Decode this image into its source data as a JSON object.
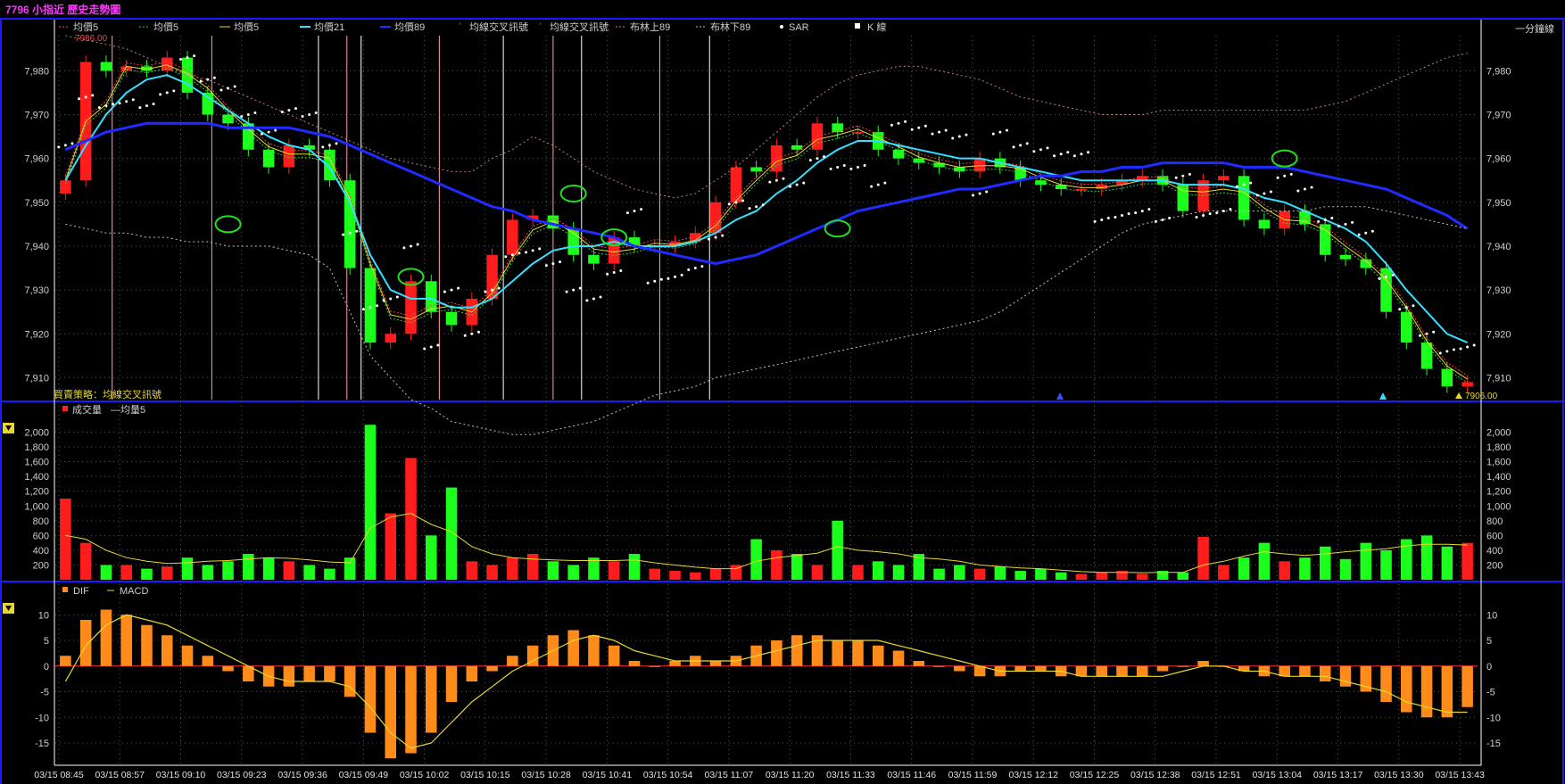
{
  "window": {
    "title": "7796 小指近  歷史走勢圖"
  },
  "price_panel": {
    "period_label": "一分鐘線",
    "high_marker": "7986.00",
    "low_marker": "7906.00",
    "strategy_label": "買賣策略：均線交叉訊號",
    "legend": [
      "均價5",
      "均價5",
      "均價5",
      "均價21",
      "均價89",
      "均線交叉訊號",
      "均線交叉訊號",
      "布林上89",
      "布林下89",
      "SAR",
      "K 線"
    ],
    "colors": {
      "ma5_a": "#ff4040",
      "ma5_b": "#39d039",
      "ma5_c": "#e6d830",
      "ma21": "#33e0ff",
      "ma89": "#1f2bff",
      "boll": "#c08080",
      "sar": "#ffffff",
      "up": "#ff1c1c",
      "down": "#1cff1c"
    }
  },
  "volume_panel": {
    "legend_vol": "成交量",
    "legend_ma": "均量5"
  },
  "macd_panel": {
    "legend_dif": "DIF",
    "legend_macd": "MACD"
  },
  "x_labels": [
    "03/15 08:45",
    "03/15 08:57",
    "03/15 09:10",
    "03/15 09:23",
    "03/15 09:36",
    "03/15 09:49",
    "03/15 10:02",
    "03/15 10:15",
    "03/15 10:28",
    "03/15 10:41",
    "03/15 10:54",
    "03/15 11:07",
    "03/15 11:20",
    "03/15 11:33",
    "03/15 11:46",
    "03/15 11:59",
    "03/15 12:12",
    "03/15 12:25",
    "03/15 12:38",
    "03/15 12:51",
    "03/15 13:04",
    "03/15 13:17",
    "03/15 13:30",
    "03/15 13:43"
  ],
  "chart_data": [
    {
      "type": "candlestick",
      "title": "7796 小指近 歷史走勢圖",
      "ylim": [
        7905,
        7988
      ],
      "yticks": [
        "7,910",
        "7,920",
        "7,930",
        "7,940",
        "7,950",
        "7,960",
        "7,970",
        "7,980"
      ],
      "series": [
        {
          "name": "K 線 (close)",
          "x": [
            "08:45",
            "08:49",
            "08:53",
            "08:57",
            "09:02",
            "09:06",
            "09:10",
            "09:14",
            "09:19",
            "09:23",
            "09:27",
            "09:32",
            "09:36",
            "09:41",
            "09:45",
            "09:49",
            "09:52",
            "09:56",
            "10:02",
            "10:06",
            "10:10",
            "10:15",
            "10:19",
            "10:23",
            "10:28",
            "10:32",
            "10:37",
            "10:41",
            "10:45",
            "10:50",
            "10:54",
            "10:58",
            "11:03",
            "11:07",
            "11:11",
            "11:16",
            "11:20",
            "11:24",
            "11:29",
            "11:33",
            "11:37",
            "11:42",
            "11:46",
            "11:50",
            "11:55",
            "11:59",
            "12:03",
            "12:08",
            "12:12",
            "12:16",
            "12:21",
            "12:25",
            "12:29",
            "12:34",
            "12:38",
            "12:42",
            "12:47",
            "12:51",
            "12:55",
            "13:00",
            "13:04",
            "13:08",
            "13:13",
            "13:17",
            "13:21",
            "13:26",
            "13:30",
            "13:34",
            "13:39",
            "13:43"
          ],
          "values": [
            7955,
            7982,
            7980,
            7981,
            7980,
            7983,
            7975,
            7970,
            7968,
            7962,
            7958,
            7963,
            7962,
            7955,
            7935,
            7918,
            7920,
            7932,
            7925,
            7922,
            7928,
            7938,
            7946,
            7947,
            7944,
            7938,
            7936,
            7942,
            7940,
            7940,
            7941,
            7943,
            7950,
            7958,
            7957,
            7963,
            7962,
            7968,
            7966,
            7966,
            7962,
            7960,
            7959,
            7958,
            7957,
            7960,
            7958,
            7955,
            7954,
            7953,
            7953,
            7954,
            7955,
            7956,
            7954,
            7948,
            7955,
            7956,
            7946,
            7944,
            7948,
            7945,
            7938,
            7937,
            7935,
            7925,
            7918,
            7912,
            7908,
            7909
          ]
        },
        {
          "name": "均價21",
          "values": [
            7955,
            7963,
            7970,
            7975,
            7978,
            7979,
            7977,
            7974,
            7971,
            7968,
            7965,
            7963,
            7962,
            7958,
            7950,
            7938,
            7930,
            7928,
            7928,
            7926,
            7926,
            7928,
            7932,
            7936,
            7939,
            7940,
            7940,
            7941,
            7940,
            7940,
            7940,
            7941,
            7943,
            7946,
            7948,
            7952,
            7955,
            7959,
            7962,
            7964,
            7964,
            7963,
            7962,
            7961,
            7960,
            7960,
            7959,
            7958,
            7957,
            7956,
            7955,
            7955,
            7955,
            7955,
            7955,
            7954,
            7954,
            7954,
            7953,
            7951,
            7950,
            7948,
            7946,
            7944,
            7941,
            7936,
            7930,
            7925,
            7920,
            7918
          ]
        },
        {
          "name": "均價89",
          "values": [
            7962,
            7964,
            7966,
            7967,
            7968,
            7968,
            7968,
            7968,
            7967,
            7967,
            7967,
            7967,
            7966,
            7965,
            7963,
            7961,
            7959,
            7957,
            7955,
            7953,
            7951,
            7949,
            7948,
            7946,
            7945,
            7944,
            7943,
            7942,
            7940,
            7939,
            7938,
            7937,
            7936,
            7937,
            7938,
            7940,
            7942,
            7944,
            7946,
            7948,
            7949,
            7950,
            7951,
            7952,
            7953,
            7953,
            7954,
            7955,
            7956,
            7956,
            7957,
            7957,
            7958,
            7958,
            7959,
            7959,
            7959,
            7959,
            7958,
            7958,
            7958,
            7957,
            7956,
            7955,
            7954,
            7953,
            7951,
            7949,
            7947,
            7944
          ]
        },
        {
          "name": "布林上89",
          "values": [
            7988,
            7987,
            7986,
            7985,
            7983,
            7981,
            7979,
            7978,
            7976,
            7974,
            7972,
            7970,
            7968,
            7966,
            7964,
            7962,
            7960,
            7959,
            7958,
            7957,
            7957,
            7960,
            7962,
            7965,
            7963,
            7960,
            7957,
            7955,
            7953,
            7952,
            7951,
            7952,
            7955,
            7958,
            7962,
            7966,
            7970,
            7974,
            7977,
            7979,
            7980,
            7981,
            7981,
            7980,
            7979,
            7978,
            7976,
            7974,
            7973,
            7972,
            7971,
            7970,
            7970,
            7970,
            7971,
            7971,
            7971,
            7971,
            7971,
            7971,
            7971,
            7971,
            7972,
            7973,
            7975,
            7977,
            7979,
            7981,
            7983,
            7984
          ]
        },
        {
          "name": "布林下89",
          "values": [
            7945,
            7944,
            7943,
            7943,
            7942,
            7942,
            7941,
            7941,
            7940,
            7940,
            7940,
            7939,
            7938,
            7935,
            7925,
            7915,
            7910,
            7905,
            7903,
            7900,
            7899,
            7898,
            7897,
            7897,
            7898,
            7899,
            7900,
            7902,
            7904,
            7906,
            7907,
            7908,
            7910,
            7911,
            7912,
            7913,
            7914,
            7915,
            7916,
            7917,
            7918,
            7919,
            7920,
            7921,
            7922,
            7923,
            7925,
            7928,
            7931,
            7934,
            7937,
            7940,
            7943,
            7945,
            7946,
            7947,
            7948,
            7948,
            7948,
            7948,
            7948,
            7948,
            7949,
            7949,
            7949,
            7948,
            7947,
            7946,
            7945,
            7944
          ]
        }
      ]
    },
    {
      "type": "bar",
      "title": "成交量",
      "ylim": [
        0,
        2200
      ],
      "yticks": [
        "200",
        "400",
        "600",
        "800",
        "1,000",
        "1,200",
        "1,400",
        "1,600",
        "1,800",
        "2,000"
      ],
      "series": [
        {
          "name": "成交量",
          "values": [
            1100,
            500,
            200,
            200,
            150,
            180,
            300,
            200,
            250,
            350,
            300,
            250,
            200,
            150,
            300,
            2100,
            900,
            1650,
            600,
            1250,
            250,
            200,
            300,
            350,
            250,
            200,
            300,
            250,
            350,
            150,
            120,
            100,
            150,
            200,
            550,
            400,
            350,
            200,
            800,
            200,
            250,
            200,
            350,
            150,
            200,
            150,
            180,
            120,
            150,
            100,
            80,
            100,
            120,
            80,
            120,
            100,
            580,
            200,
            300,
            500,
            250,
            300,
            450,
            280,
            500,
            400,
            550,
            600,
            450,
            500
          ]
        },
        {
          "name": "均量5",
          "values": [
            600,
            550,
            400,
            300,
            250,
            220,
            230,
            250,
            260,
            280,
            300,
            290,
            270,
            240,
            230,
            700,
            850,
            900,
            750,
            650,
            450,
            350,
            300,
            280,
            270,
            260,
            260,
            260,
            270,
            230,
            200,
            170,
            150,
            150,
            250,
            300,
            330,
            360,
            450,
            400,
            380,
            350,
            300,
            280,
            250,
            200,
            180,
            160,
            150,
            130,
            110,
            100,
            100,
            95,
            100,
            100,
            200,
            250,
            320,
            380,
            350,
            330,
            350,
            380,
            400,
            420,
            460,
            480,
            480,
            470
          ]
        }
      ]
    },
    {
      "type": "bar",
      "title": "MACD",
      "ylim": [
        -19,
        13
      ],
      "yticks": [
        "-15",
        "-10",
        "-5",
        "0",
        "5",
        "10"
      ],
      "series": [
        {
          "name": "DIF",
          "values": [
            2,
            9,
            11,
            10,
            8,
            6,
            4,
            2,
            -1,
            -3,
            -4,
            -4,
            -3,
            -3,
            -6,
            -13,
            -18,
            -17,
            -13,
            -7,
            -3,
            -1,
            2,
            4,
            6,
            7,
            6,
            4,
            1,
            0,
            1,
            2,
            1,
            2,
            4,
            5,
            6,
            6,
            5,
            5,
            4,
            3,
            1,
            0,
            -1,
            -2,
            -2,
            -1,
            -1,
            -2,
            -2,
            -2,
            -2,
            -2,
            -1,
            0,
            1,
            0,
            -1,
            -2,
            -2,
            -2,
            -3,
            -4,
            -5,
            -7,
            -9,
            -10,
            -10,
            -8
          ]
        },
        {
          "name": "MACD",
          "values": [
            -3,
            4,
            8,
            10,
            9,
            8,
            6,
            4,
            2,
            0,
            -2,
            -3,
            -3,
            -3,
            -4,
            -8,
            -13,
            -16,
            -15,
            -11,
            -7,
            -4,
            -1,
            1,
            3,
            5,
            6,
            5,
            3,
            2,
            1,
            1,
            1,
            1,
            2,
            3,
            4,
            5,
            5,
            5,
            5,
            4,
            3,
            2,
            1,
            0,
            -1,
            -1,
            -1,
            -1,
            -2,
            -2,
            -2,
            -2,
            -2,
            -1,
            0,
            0,
            -1,
            -1,
            -2,
            -2,
            -2,
            -3,
            -4,
            -5,
            -7,
            -8,
            -9,
            -9
          ]
        }
      ]
    }
  ]
}
